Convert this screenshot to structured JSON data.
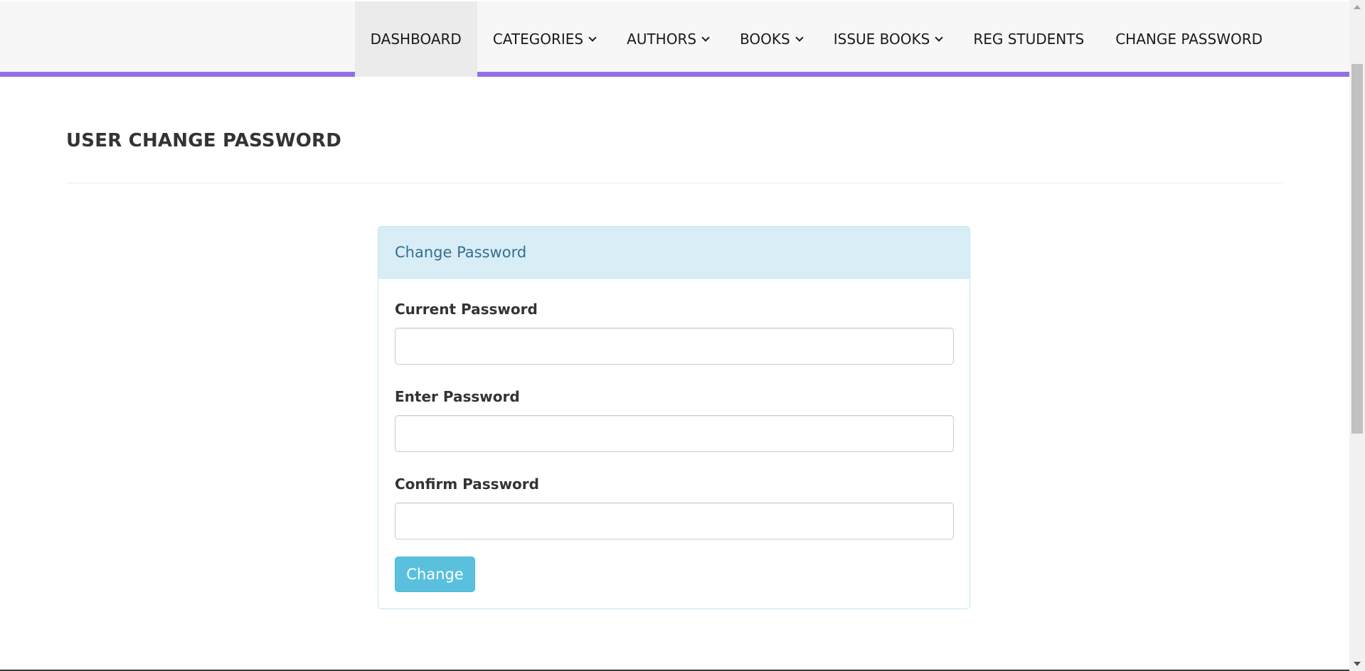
{
  "nav": {
    "items": [
      {
        "label": "DASHBOARD",
        "active": true,
        "dropdown": false
      },
      {
        "label": "CATEGORIES",
        "active": false,
        "dropdown": true
      },
      {
        "label": "AUTHORS",
        "active": false,
        "dropdown": true
      },
      {
        "label": "BOOKS",
        "active": false,
        "dropdown": true
      },
      {
        "label": "ISSUE BOOKS",
        "active": false,
        "dropdown": true
      },
      {
        "label": "REG STUDENTS",
        "active": false,
        "dropdown": false
      },
      {
        "label": "CHANGE PASSWORD",
        "active": false,
        "dropdown": false
      }
    ],
    "accent_color": "#9170e4"
  },
  "header": {
    "title": "USER CHANGE PASSWORD"
  },
  "panel": {
    "heading": "Change Password",
    "fields": [
      {
        "label": "Current Password",
        "value": "",
        "placeholder": ""
      },
      {
        "label": "Enter Password",
        "value": "",
        "placeholder": ""
      },
      {
        "label": "Confirm Password",
        "value": "",
        "placeholder": ""
      }
    ],
    "submit_label": "Change",
    "button_color": "#5bc0de",
    "heading_color": "#31708f"
  }
}
